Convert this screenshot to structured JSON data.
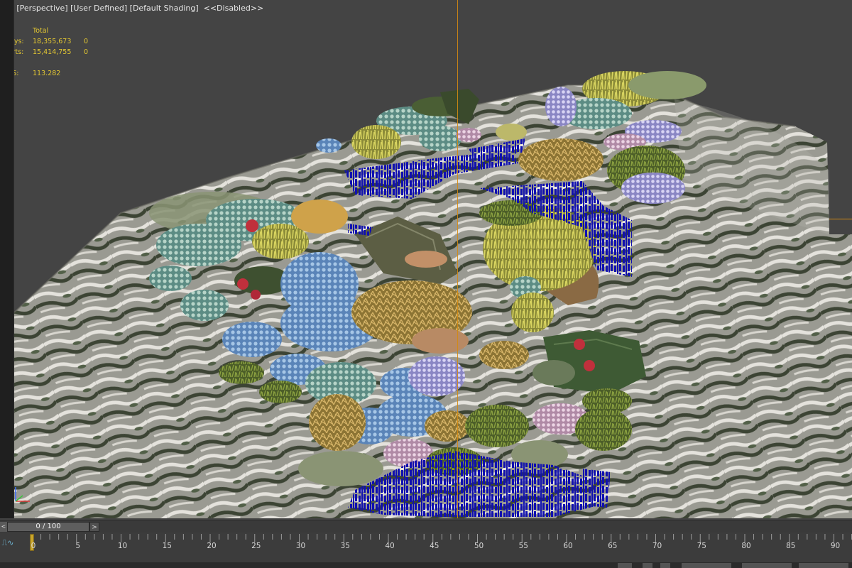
{
  "viewport": {
    "label": {
      "plus": "[+]",
      "view": "[Perspective]",
      "mode": "[User Defined]",
      "shading": "[Default Shading]",
      "state": "<<Disabled>>"
    },
    "stats": {
      "header": "Total",
      "polys_label": "Polys:",
      "polys_value": "18,355,673",
      "polys_sel": "0",
      "verts_label": "Verts:",
      "verts_value": "15,414,755",
      "verts_sel": "0",
      "fps_label": "FPS:",
      "fps_value": "113.282"
    },
    "colors": {
      "background": "#444444",
      "stats_text": "#e2c632",
      "crosshair": "#d48a12",
      "selection_blue": "#1010b0"
    }
  },
  "timeline": {
    "prev_label": "<",
    "slider_text": "0 / 100",
    "next_label": ">",
    "curve_icon": "curve-editor-icon",
    "current_frame": 0,
    "ticks": [
      "0",
      "5",
      "10",
      "15",
      "20",
      "25",
      "30",
      "35",
      "40",
      "45",
      "50",
      "55",
      "60",
      "65",
      "70",
      "75",
      "80",
      "85",
      "90"
    ]
  }
}
